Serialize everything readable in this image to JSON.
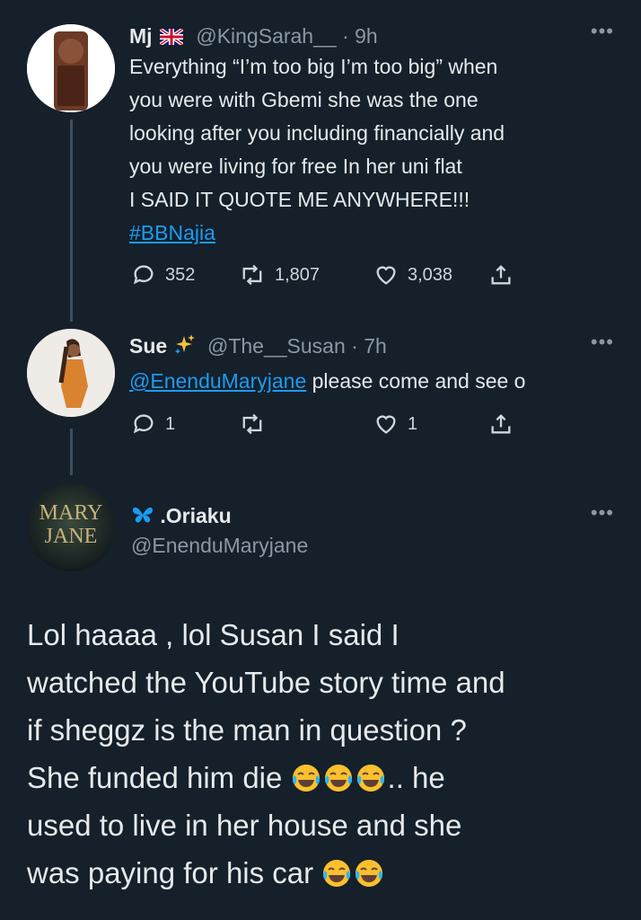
{
  "tweets": [
    {
      "display_name": "Mj",
      "handle": "@KingSarah__",
      "time": "9h",
      "lines": [
        "Everything “I’m too big I’m too big” when",
        "you were with Gbemi she was the one",
        "looking after you including financially and",
        "you were living for free In her uni flat",
        "I SAID IT QUOTE ME ANYWHERE!!!"
      ],
      "hashtag": "#BBNajia",
      "replies": "352",
      "retweets": "1,807",
      "likes": "3,038"
    },
    {
      "display_name": "Sue",
      "handle": "@The__Susan",
      "time": "7h",
      "mention": "@EnenduMaryjane",
      "text_after_mention": "please come and see o",
      "replies": "1",
      "retweets": "",
      "likes": "1"
    }
  ],
  "main_tweet": {
    "display_name": ".Oriaku",
    "handle": "@EnenduMaryjane",
    "avatar_text": [
      "MARY",
      "JANE"
    ],
    "line1": "Lol haaaa , lol Susan I said I",
    "line2": "watched the YouTube story time and",
    "line3": "if sheggz is the man in question ?",
    "line4_before": "She funded him die",
    "line4_after": ".. he",
    "line5": "used to live in her house and she",
    "line6_before": "was paying for his car"
  },
  "icons": {
    "flag": "uk-flag-icon",
    "sparkles": "sparkles-icon",
    "butterfly": "butterfly-icon",
    "emoji": "face-with-tears-of-joy-icon"
  },
  "colors": {
    "background": "#15202b",
    "link": "#1d9bf0",
    "text": "#e7e9ea",
    "muted": "#8b98a5"
  }
}
